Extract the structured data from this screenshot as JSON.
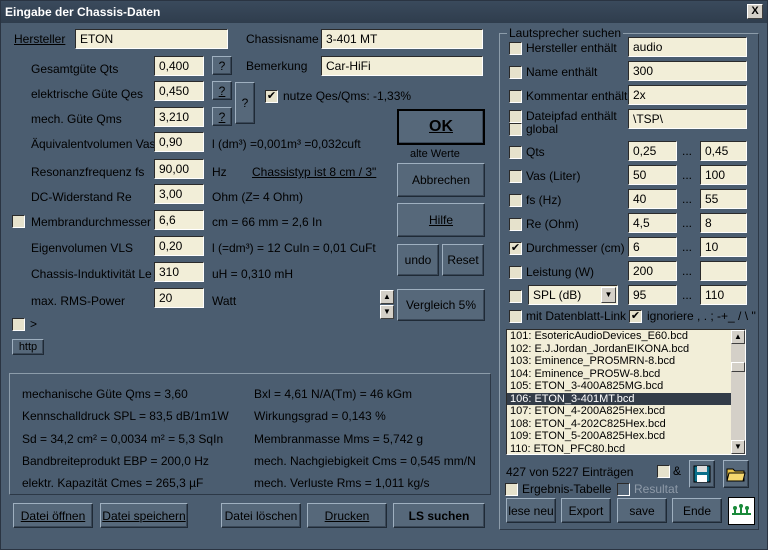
{
  "window": {
    "title": "Eingabe der Chassis-Daten",
    "close_glyph": "X"
  },
  "left": {
    "hersteller_label": "Hersteller",
    "hersteller_value": "ETON",
    "chassisname_label": "Chassisname",
    "chassisname_value": "3-401 MT",
    "bemerkung_label": "Bemerkung",
    "bemerkung_value": "Car-HiFi",
    "params": [
      {
        "label": "Gesamtgüte Qts",
        "value": "0,400",
        "help": "?"
      },
      {
        "label": "elektrische Güte Qes",
        "value": "0,450",
        "help": "?"
      },
      {
        "label": "mech. Güte Qms",
        "value": "3,210",
        "help": "?"
      },
      {
        "label": "Äquivalentvolumen Vas",
        "value": "0,90",
        "info": "l (dm³) =0,001m³ =0,032cuft"
      },
      {
        "label": "Resonanzfrequenz fs",
        "value": "90,00",
        "info": "Hz"
      },
      {
        "label": "DC-Widerstand Re",
        "value": "3,00",
        "info": "Ohm (Z= 4 Ohm)"
      },
      {
        "label": "Membrandurchmesser d",
        "value": "6,6",
        "info": "cm = 66 mm = 2,6 In"
      },
      {
        "label": "Eigenvolumen VLS",
        "value": "0,20",
        "info": "l (=dm³) = 12 CuIn = 0,01 CuFt"
      },
      {
        "label": "Chassis-Induktivität Le",
        "value": "310",
        "info": "uH = 0,310 mH"
      },
      {
        "label": "max. RMS-Power",
        "value": "20",
        "info": "Watt"
      }
    ],
    "big_help": "?",
    "nutze_label": "nutze Qes/Qms: -1,33%",
    "chassistyp": "Chassistyp ist 8 cm / 3\"",
    "gt_label": ">",
    "http_label": "http"
  },
  "buttons": {
    "ok": "OK",
    "alte_werte": "alte Werte",
    "abbrechen": "Abbrechen",
    "hilfe": "Hilfe",
    "undo": "undo",
    "reset": "Reset",
    "vergleich": "Vergleich 5%",
    "datei_oeffnen": "Datei öffnen",
    "datei_speichern": "Datei speichern",
    "datei_loeschen": "Datei löschen",
    "drucken": "Drucken",
    "ls_suchen": "LS suchen"
  },
  "results": {
    "col1": [
      "mechanische Güte Qms = 3,60",
      "Kennschalldruck SPL = 83,5 dB/1m1W",
      "Sd = 34,2 cm² = 0,0034 m² = 5,3 SqIn",
      "Bandbreiteprodukt EBP = 200,0 Hz",
      "elektr. Kapazität Cmes = 265,3 µF"
    ],
    "col2": [
      "Bxl = 4,61 N/A(Tm) = 46 kGm",
      "Wirkungsgrad = 0,143 %",
      "Membranmasse Mms = 5,742 g",
      "mech. Nachgiebigkeit Cms = 0,545 mm/N",
      "mech. Verluste Rms = 1,011 kg/s"
    ]
  },
  "search": {
    "group_title": "Lautsprecher suchen",
    "text_filters": [
      {
        "label": "Hersteller enthält",
        "value": "audio"
      },
      {
        "label": "Name enthält",
        "value": "300"
      },
      {
        "label": "Kommentar enthält",
        "value": "2x"
      },
      {
        "label": "Dateipfad enthält",
        "value": "\\TSP\\"
      }
    ],
    "global_label": "global",
    "range_filters": [
      {
        "label": "Qts",
        "min": "0,25",
        "max": "0,45",
        "checked": false
      },
      {
        "label": "Vas (Liter)",
        "min": "50",
        "max": "100",
        "checked": false
      },
      {
        "label": "fs (Hz)",
        "min": "40",
        "max": "55",
        "checked": false
      },
      {
        "label": "Re (Ohm)",
        "min": "4,5",
        "max": "8",
        "checked": false
      },
      {
        "label": "Durchmesser (cm)",
        "min": "6",
        "max": "10",
        "checked": true
      },
      {
        "label": "Leistung (W)",
        "min": "200",
        "max": "",
        "checked": false
      }
    ],
    "range_sep": "...",
    "spl_combo": "SPL (dB)",
    "spl_min": "95",
    "spl_max": "110",
    "datenblatt_label": "mit Datenblatt-Link",
    "ignoriere_label": "ignoriere , . ; -+_ / \\ ''",
    "list": [
      "101: EsotericAudioDevices_E60.bcd",
      "102: E.J.Jordan_JordanEIKONA.bcd",
      "103: Eminence_PRO5MRN-8.bcd",
      "104: Eminence_PRO5W-8.bcd",
      "105: ETON_3-400A825MG.bcd",
      "106: ETON_3-401MT.bcd",
      "107: ETON_4-200A825Hex.bcd",
      "108: ETON_4-202C825Hex.bcd",
      "109: ETON_5-200A825Hex.bcd",
      "110: ETON_PFC80.bcd"
    ],
    "selected_index": 5,
    "count_text": "427 von 5227 Einträgen",
    "amp_label": "&",
    "ergebnis_label": "Ergebnis-Tabelle",
    "resultat_label": "Resultat",
    "buttons": {
      "lese_neu": "lese neu",
      "export": "Export",
      "save": "save",
      "ende": "Ende"
    }
  }
}
